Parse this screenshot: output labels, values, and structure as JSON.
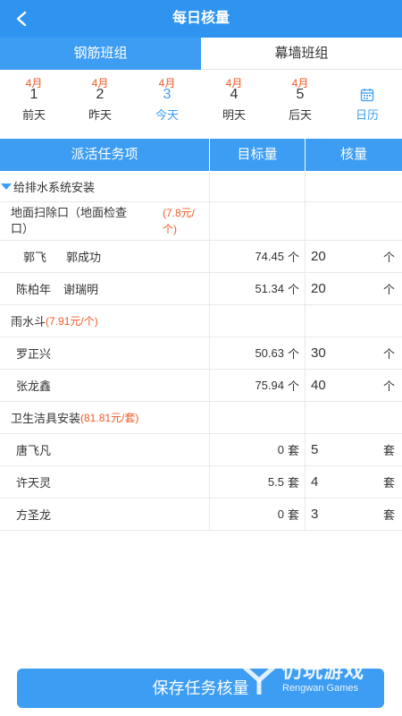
{
  "header": {
    "title": "每日核量",
    "back_icon": "chevron-left-icon"
  },
  "tabs": [
    {
      "label": "钢筋班组",
      "active": true
    },
    {
      "label": "幕墙班组",
      "active": false
    }
  ],
  "dates": [
    {
      "month": "4月",
      "day": "1",
      "label": "前天"
    },
    {
      "month": "4月",
      "day": "2",
      "label": "昨天"
    },
    {
      "month": "4月",
      "day": "3",
      "label": "今天",
      "today": true
    },
    {
      "month": "4月",
      "day": "4",
      "label": "明天"
    },
    {
      "month": "4月",
      "day": "5",
      "label": "后天"
    }
  ],
  "calendar": {
    "label": "日历",
    "icon": "calendar-icon"
  },
  "table": {
    "headers": [
      "派活任务项",
      "目标量",
      "核量"
    ],
    "group": {
      "name": "给排水系统安装"
    },
    "tasks": [
      {
        "name": "地面扫除口（地面检查口）",
        "name_line1": "地面扫除口（地面检查",
        "name_line2": "口）",
        "price": "(7.8元/个)",
        "price_line1": "(7.8元/",
        "price_line2": "个)",
        "rows": [
          {
            "workers": [
              "郭飞",
              "郭成功"
            ],
            "target": "74.45",
            "unit": "个",
            "qty": "20",
            "qty_unit": "个"
          },
          {
            "workers": [
              "陈柏年",
              "谢瑞明"
            ],
            "target": "51.34",
            "unit": "个",
            "qty": "20",
            "qty_unit": "个"
          }
        ]
      },
      {
        "name": "雨水斗",
        "price": "(7.91元/个)",
        "rows": [
          {
            "workers": [
              "罗正兴"
            ],
            "target": "50.63",
            "unit": "个",
            "qty": "30",
            "qty_unit": "个"
          },
          {
            "workers": [
              "张龙鑫"
            ],
            "target": "75.94",
            "unit": "个",
            "qty": "40",
            "qty_unit": "个"
          }
        ]
      },
      {
        "name": "卫生洁具安装",
        "price": "(81.81元/套)",
        "rows": [
          {
            "workers": [
              "唐飞凡"
            ],
            "target": "0",
            "unit": "套",
            "qty": "5",
            "qty_unit": "套"
          },
          {
            "workers": [
              "许天灵"
            ],
            "target": "5.5",
            "unit": "套",
            "qty": "4",
            "qty_unit": "套"
          },
          {
            "workers": [
              "方圣龙"
            ],
            "target": "0",
            "unit": "套",
            "qty": "3",
            "qty_unit": "套"
          }
        ]
      }
    ]
  },
  "save_button": "保存任务核量",
  "watermark": {
    "title": "仍玩游戏",
    "subtitle": "Rengwan Games"
  },
  "colors": {
    "primary": "#3d9df3",
    "header": "#2f93f0",
    "accent": "#f05a24"
  }
}
